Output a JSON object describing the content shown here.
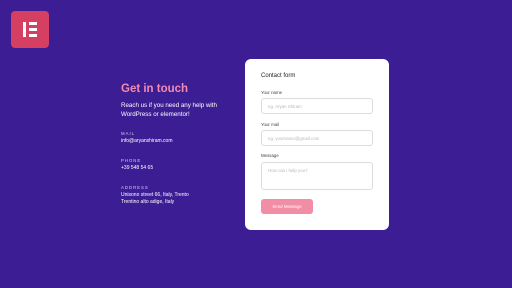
{
  "brand": {
    "logo_icon": "elementor-logo-icon",
    "logo_color": "#d53f62"
  },
  "colors": {
    "background": "#3d1d94",
    "accent": "#f28bb0",
    "button": "#f28da6"
  },
  "info": {
    "heading": "Get in touch",
    "tagline": "Reach us if you need any help with WordPress or elementor!",
    "mail_label": "MAIL",
    "mail_value": "info@aryanshiram.com",
    "phone_label": "PHONE",
    "phone_value": "+39 548 54 65",
    "address_label": "ADDRESS",
    "address_line1": "Unisono street 66, Italy, Trento",
    "address_line2": "Trentino alto adige, Italy"
  },
  "form": {
    "title": "Contact form",
    "name_label": "Your name",
    "name_placeholder": "eg. Aryan Shiram",
    "mail_label": "Your mail",
    "mail_placeholder": "eg. yourname@gmail.com",
    "message_label": "Message",
    "message_placeholder": "How can i help you?",
    "send_label": "Send Message"
  }
}
